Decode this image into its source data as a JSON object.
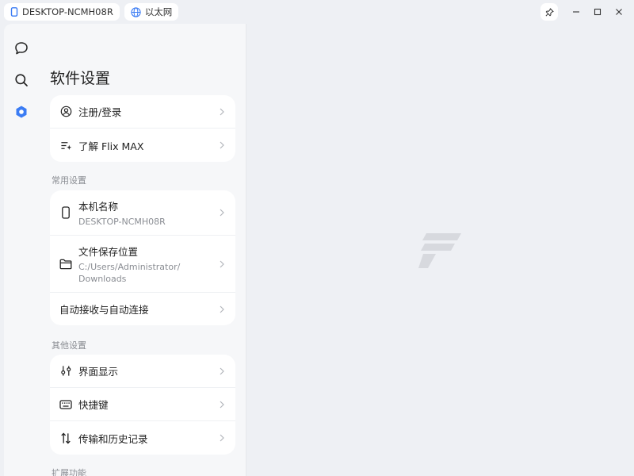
{
  "titlebar": {
    "device_chip": "DESKTOP-NCMH08R",
    "network_chip": "以太网",
    "controls": [
      "pin-icon",
      "minimize-icon",
      "maximize-icon",
      "close-icon"
    ]
  },
  "rail": {
    "items": [
      {
        "icon": "chat-bubble-icon"
      },
      {
        "icon": "search-icon"
      },
      {
        "icon": "settings-hexagon-icon",
        "active": true
      }
    ]
  },
  "settings": {
    "title": "软件设置",
    "account": [
      {
        "label": "注册/登录",
        "icon": "user-circle-icon"
      },
      {
        "label": "了解 Flix MAX",
        "icon": "sparkle-list-icon"
      }
    ],
    "common_title": "常用设置",
    "common": [
      {
        "label": "本机名称",
        "sub": "DESKTOP-NCMH08R",
        "icon": "phone-icon"
      },
      {
        "label": "文件保存位置",
        "sub1": "C:/Users/Administrator/",
        "sub2": "Downloads",
        "icon": "folder-icon"
      },
      {
        "label": "自动接收与自动连接"
      }
    ],
    "other_title": "其他设置",
    "other": [
      {
        "label": "界面显示",
        "icon": "sliders-icon"
      },
      {
        "label": "快捷键",
        "icon": "keyboard-icon"
      },
      {
        "label": "传输和历史记录",
        "icon": "transfer-arrows-icon"
      }
    ],
    "ext_title": "扩展功能"
  },
  "colors": {
    "accent": "#3b7cf4",
    "background": "#eef0f4",
    "panel": "#f6f7f9",
    "card": "#ffffff"
  }
}
